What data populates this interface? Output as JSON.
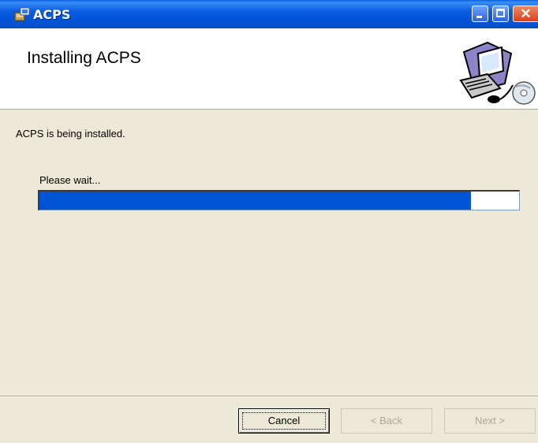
{
  "window": {
    "title": "ACPS",
    "icon": "installer-icon"
  },
  "banner": {
    "heading": "Installing ACPS",
    "art": "computer-cd-graphic"
  },
  "main": {
    "status_text": "ACPS is being installed.",
    "wait_text": "Please wait...",
    "progress": 0.9
  },
  "buttons": {
    "cancel": "Cancel",
    "back": "< Back",
    "next": "Next >"
  },
  "colors": {
    "titlebar": "#0254d7",
    "progress_fill": "#0055d4",
    "dialog_bg": "#ece9d8"
  }
}
